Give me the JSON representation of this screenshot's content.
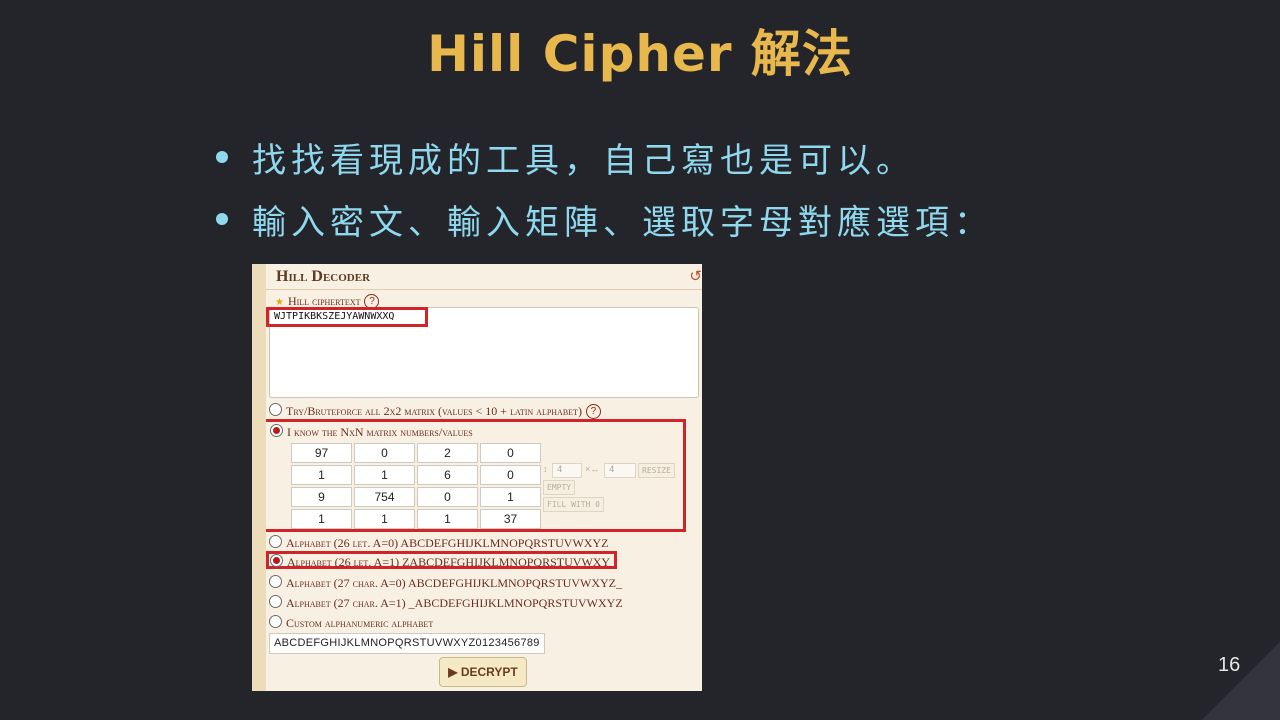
{
  "slide": {
    "title": "Hill Cipher 解法",
    "bullets": [
      "找找看現成的工具，自己寫也是可以。",
      "輸入密文、輸入矩陣、選取字母對應選項："
    ],
    "page_number": "16"
  },
  "decoder": {
    "title": "Hill Decoder",
    "ciphertext_label": "Hill ciphertext",
    "ciphertext_value": "WJTPIKBKSZEJYAWNWXXQ",
    "option_bruteforce": "Try/Bruteforce all 2x2 matrix (values < 10 + latin alphabet)",
    "option_known": "I know the NxN matrix numbers/values",
    "matrix": [
      [
        "97",
        "0",
        "2",
        "0"
      ],
      [
        "1",
        "1",
        "6",
        "0"
      ],
      [
        "9",
        "754",
        "0",
        "1"
      ],
      [
        "1",
        "1",
        "1",
        "37"
      ]
    ],
    "rows_value": "4",
    "cols_value": "4",
    "resize_label": "RESIZE",
    "empty_label": "EMPTY",
    "fill_label": "FILL WITH 0",
    "alphabet_options": [
      "Alphabet (26 let. A=0) ABCDEFGHIJKLMNOPQRSTUVWXYZ",
      "Alphabet (26 let. A=1) ZABCDEFGHIJKLMNOPQRSTUVWXY",
      "Alphabet (27 char. A=0) ABCDEFGHIJKLMNOPQRSTUVWXYZ_",
      "Alphabet (27 char. A=1) _ABCDEFGHIJKLMNOPQRSTUVWXYZ",
      "Custom alphanumeric alphabet"
    ],
    "selected_alphabet_index": 1,
    "custom_alphabet_value": "ABCDEFGHIJKLMNOPQRSTUVWXYZ0123456789",
    "decrypt_label": "DECRYPT",
    "help_glyph": "?"
  },
  "colors": {
    "background": "#24252b",
    "title": "#e8b84d",
    "bullet_text": "#8fd8ee",
    "highlight_box": "#d1232a"
  },
  "icons": [
    "star-icon",
    "help-icon",
    "reset-icon",
    "play-icon",
    "radio-icon"
  ]
}
